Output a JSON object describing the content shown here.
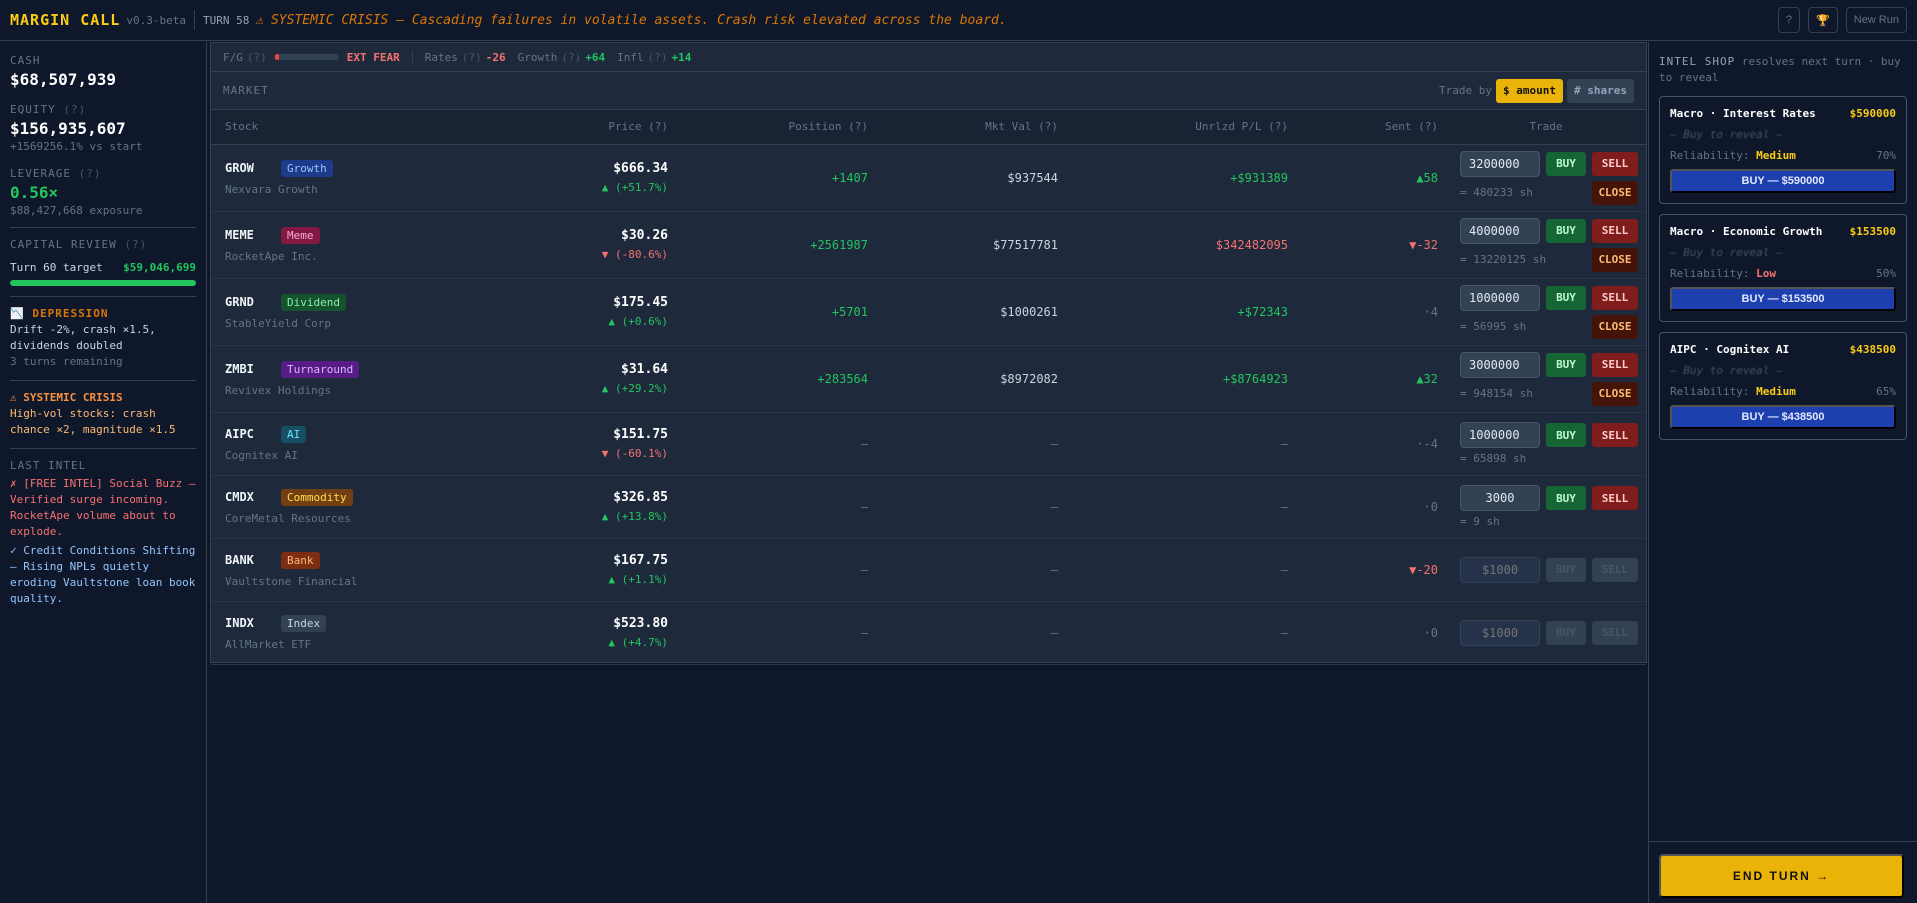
{
  "header": {
    "title": "MARGIN CALL",
    "version": "v0.3-beta",
    "turn": "TURN 58",
    "event": "⚠ SYSTEMIC CRISIS — Cascading failures in volatile assets. Crash risk elevated across the board.",
    "help": "?",
    "trophy": "🏆",
    "new_run": "New Run"
  },
  "sidebar": {
    "cash_label": "CASH",
    "cash": "$68,507,939",
    "equity_label": "EQUITY",
    "equity": "$156,935,607",
    "equity_sub": "+1569256.1% vs start",
    "leverage_label": "LEVERAGE",
    "leverage": "0.56×",
    "exposure": "$88,427,668 exposure",
    "q": "(?)",
    "review_label": "CAPITAL REVIEW",
    "review_turn": "Turn 60 target",
    "review_target": "$59,046,699",
    "review_progress": 1.0,
    "regime_icon": "📉",
    "regime": "DEPRESSION",
    "regime_desc": "Drift -2%, crash ×1.5, dividends doubled",
    "regime_remaining": "3 turns remaining",
    "crisis_title": "⚠ SYSTEMIC CRISIS",
    "crisis_desc": "High-vol stocks: crash chance ×2, magnitude ×1.5",
    "intel_label": "LAST INTEL",
    "intel_1": "✗ [FREE INTEL] Social Buzz — Verified surge incoming. RocketApe volume about to explode.",
    "intel_2": "✓ Credit Conditions Shifting — Rising NPLs quietly eroding Vaultstone loan book quality."
  },
  "macro": {
    "fg_label": "F/G",
    "fg_state": "EXT FEAR",
    "fg_level": 0.05,
    "q": "(?)",
    "rates_label": "Rates",
    "rates": "-26",
    "growth_label": "Growth",
    "growth": "+64",
    "infl_label": "Infl",
    "infl": "+14"
  },
  "market": {
    "title": "MARKET",
    "trade_by": "Trade by",
    "mode_amount": "$ amount",
    "mode_shares": "# shares",
    "columns": [
      "Stock",
      "Price (?)",
      "Position (?)",
      "Mkt Val (?)",
      "Unrlzd P/L (?)",
      "Sent (?)",
      "Trade"
    ],
    "buy": "BUY",
    "sell": "SELL",
    "close": "CLOSE",
    "stocks": [
      {
        "ticker": "GROW",
        "tag": "Growth",
        "tag_bg": "#1e3a8a",
        "tag_fg": "#93c5fd",
        "name": "Nexvara Growth",
        "price": "$666.34",
        "change": "▲ (+51.7%)",
        "dir": "up",
        "position": "+1407",
        "mkt_val": "$937544",
        "pnl": "+$931389",
        "pnl_dir": "up",
        "sent": "▲58",
        "sent_dir": "up",
        "amount": "3200000",
        "shares": "= 480233 sh",
        "can_close": true,
        "enabled": true
      },
      {
        "ticker": "MEME",
        "tag": "Meme",
        "tag_bg": "#831843",
        "tag_fg": "#f9a8d4",
        "name": "RocketApe Inc.",
        "price": "$30.26",
        "change": "▼ (-80.6%)",
        "dir": "down",
        "position": "+2561987",
        "mkt_val": "$77517781",
        "pnl": "$342482095",
        "pnl_dir": "down",
        "sent": "▼-32",
        "sent_dir": "down",
        "amount": "4000000",
        "shares": "= 13220125 sh",
        "can_close": true,
        "enabled": true
      },
      {
        "ticker": "GRND",
        "tag": "Dividend",
        "tag_bg": "#14532d",
        "tag_fg": "#86efac",
        "name": "StableYield Corp",
        "price": "$175.45",
        "change": "▲ (+0.6%)",
        "dir": "up",
        "position": "+5701",
        "mkt_val": "$1000261",
        "pnl": "+$72343",
        "pnl_dir": "up",
        "sent": "·4",
        "sent_dir": "neutral",
        "amount": "1000000",
        "shares": "= 56995 sh",
        "can_close": true,
        "enabled": true
      },
      {
        "ticker": "ZMBI",
        "tag": "Turnaround",
        "tag_bg": "#581c87",
        "tag_fg": "#d8b4fe",
        "name": "Revivex Holdings",
        "price": "$31.64",
        "change": "▲ (+29.2%)",
        "dir": "up",
        "position": "+283564",
        "mkt_val": "$8972082",
        "pnl": "+$8764923",
        "pnl_dir": "up",
        "sent": "▲32",
        "sent_dir": "up",
        "amount": "3000000",
        "shares": "= 948154 sh",
        "can_close": true,
        "enabled": true
      },
      {
        "ticker": "AIPC",
        "tag": "AI",
        "tag_bg": "#164e63",
        "tag_fg": "#67e8f9",
        "name": "Cognitex AI",
        "price": "$151.75",
        "change": "▼ (-60.1%)",
        "dir": "down",
        "position": "—",
        "mkt_val": "—",
        "pnl": "—",
        "pnl_dir": "neutral",
        "sent": "·-4",
        "sent_dir": "neutral",
        "amount": "1000000",
        "shares": "= 65898 sh",
        "can_close": false,
        "enabled": true
      },
      {
        "ticker": "CMDX",
        "tag": "Commodity",
        "tag_bg": "#713f12",
        "tag_fg": "#fde047",
        "name": "CoreMetal Resources",
        "price": "$326.85",
        "change": "▲ (+13.8%)",
        "dir": "up",
        "position": "—",
        "mkt_val": "—",
        "pnl": "—",
        "pnl_dir": "neutral",
        "sent": "·0",
        "sent_dir": "neutral",
        "amount": "3000",
        "shares": "= 9 sh",
        "can_close": false,
        "enabled": true
      },
      {
        "ticker": "BANK",
        "tag": "Bank",
        "tag_bg": "#7c2d12",
        "tag_fg": "#fdba74",
        "name": "Vaultstone Financial",
        "price": "$167.75",
        "change": "▲ (+1.1%)",
        "dir": "up",
        "position": "—",
        "mkt_val": "—",
        "pnl": "—",
        "pnl_dir": "neutral",
        "sent": "▼-20",
        "sent_dir": "down",
        "placeholder": "$1000",
        "can_close": false,
        "enabled": false
      },
      {
        "ticker": "INDX",
        "tag": "Index",
        "tag_bg": "#334155",
        "tag_fg": "#cbd5e1",
        "name": "AllMarket ETF",
        "price": "$523.80",
        "change": "▲ (+4.7%)",
        "dir": "up",
        "position": "—",
        "mkt_val": "—",
        "pnl": "—",
        "pnl_dir": "neutral",
        "sent": "·0",
        "sent_dir": "neutral",
        "placeholder": "$1000",
        "can_close": false,
        "enabled": false
      }
    ]
  },
  "shop": {
    "title": "INTEL SHOP",
    "subtitle": "resolves next turn · buy to reveal",
    "reliability_label": "Reliability:",
    "items": [
      {
        "title": "Macro · Interest Rates",
        "price": "$590000",
        "hidden": "— Buy to reveal —",
        "reliability": "Medium",
        "rel_color": "#facc15",
        "pct": "70%",
        "button": "BUY — $590000"
      },
      {
        "title": "Macro · Economic Growth",
        "price": "$153500",
        "hidden": "— Buy to reveal —",
        "reliability": "Low",
        "rel_color": "#f87171",
        "pct": "50%",
        "button": "BUY — $153500"
      },
      {
        "title": "AIPC · Cognitex AI",
        "price": "$438500",
        "hidden": "— Buy to reveal —",
        "reliability": "Medium",
        "rel_color": "#facc15",
        "pct": "65%",
        "button": "BUY — $438500"
      }
    ]
  },
  "end_turn": "END TURN →"
}
